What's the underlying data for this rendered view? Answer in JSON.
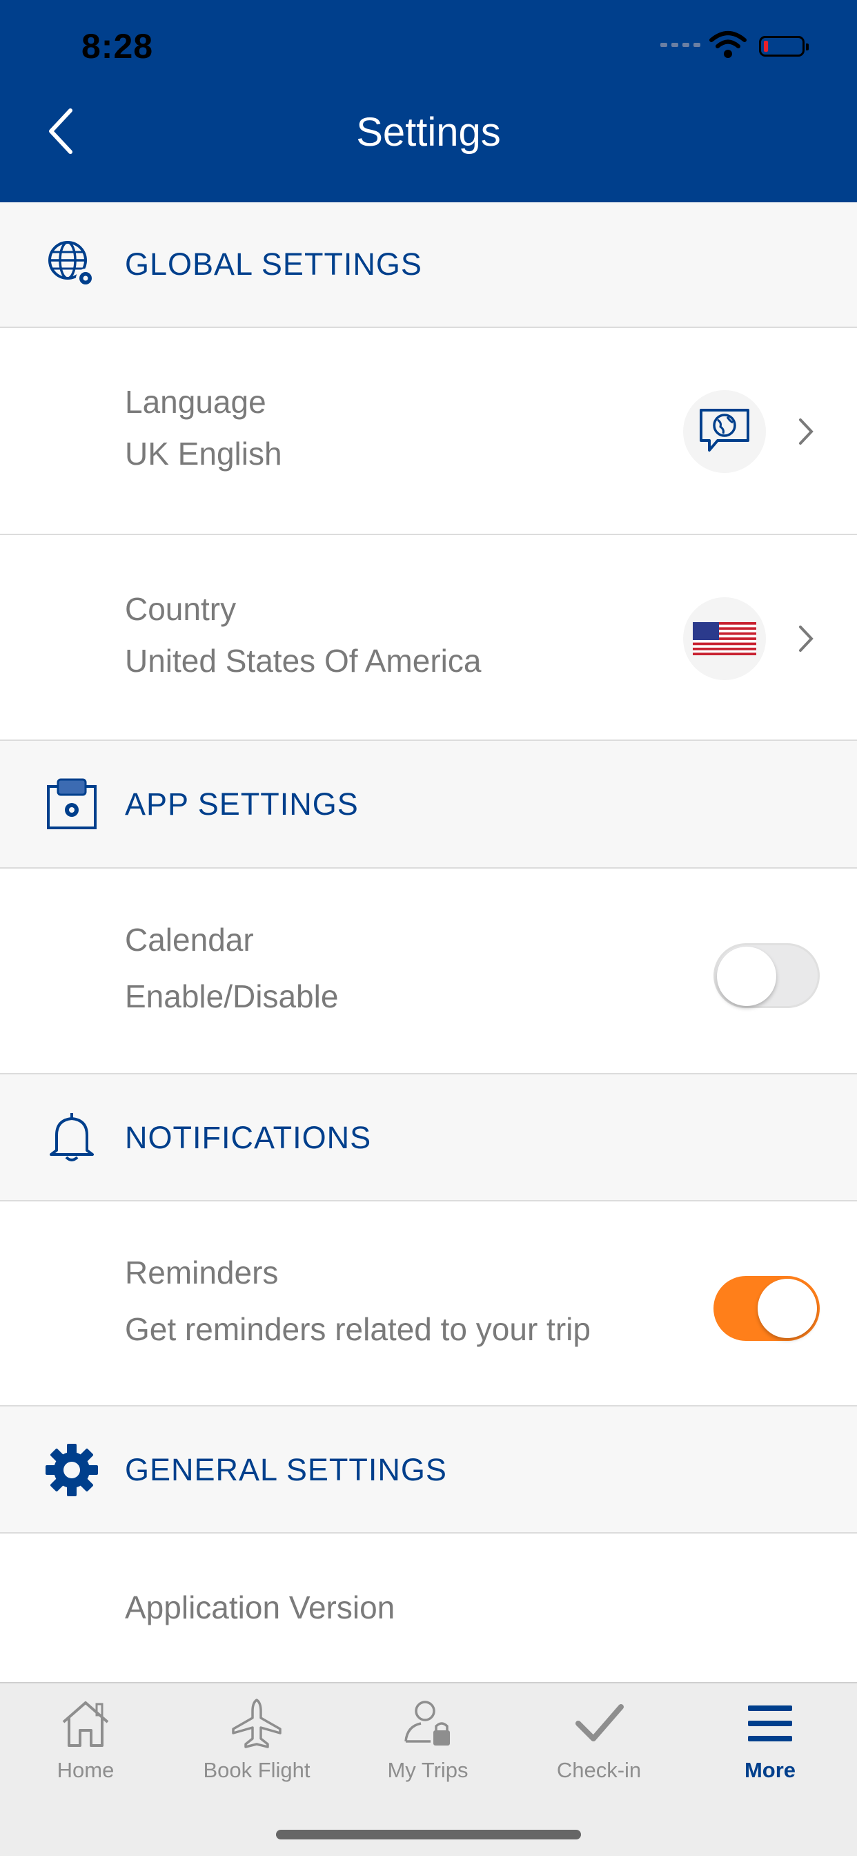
{
  "status_bar": {
    "time": "8:28"
  },
  "header": {
    "title": "Settings"
  },
  "sections": {
    "global": {
      "title": "GLOBAL SETTINGS"
    },
    "app": {
      "title": "APP SETTINGS"
    },
    "notifications": {
      "title": "NOTIFICATIONS"
    },
    "general": {
      "title": "GENERAL SETTINGS"
    }
  },
  "rows": {
    "language": {
      "label": "Language",
      "value": "UK English",
      "icon": "globe-speech-bubble-icon"
    },
    "country": {
      "label": "Country",
      "value": "United States Of America",
      "icon": "us-flag-icon"
    },
    "calendar": {
      "label": "Calendar",
      "value": "Enable/Disable",
      "enabled": false
    },
    "reminders": {
      "label": "Reminders",
      "value": "Get reminders related to your trip",
      "enabled": true
    },
    "app_version": {
      "label": "Application Version"
    }
  },
  "tabbar": {
    "items": [
      {
        "label": "Home",
        "icon": "home-icon"
      },
      {
        "label": "Book Flight",
        "icon": "plane-icon"
      },
      {
        "label": "My Trips",
        "icon": "user-lock-icon"
      },
      {
        "label": "Check-in",
        "icon": "check-icon"
      },
      {
        "label": "More",
        "icon": "menu-icon",
        "active": true
      }
    ]
  },
  "colors": {
    "brand": "#003F8C",
    "accent": "#FF7F1A",
    "section_bg": "#F7F7F7"
  }
}
